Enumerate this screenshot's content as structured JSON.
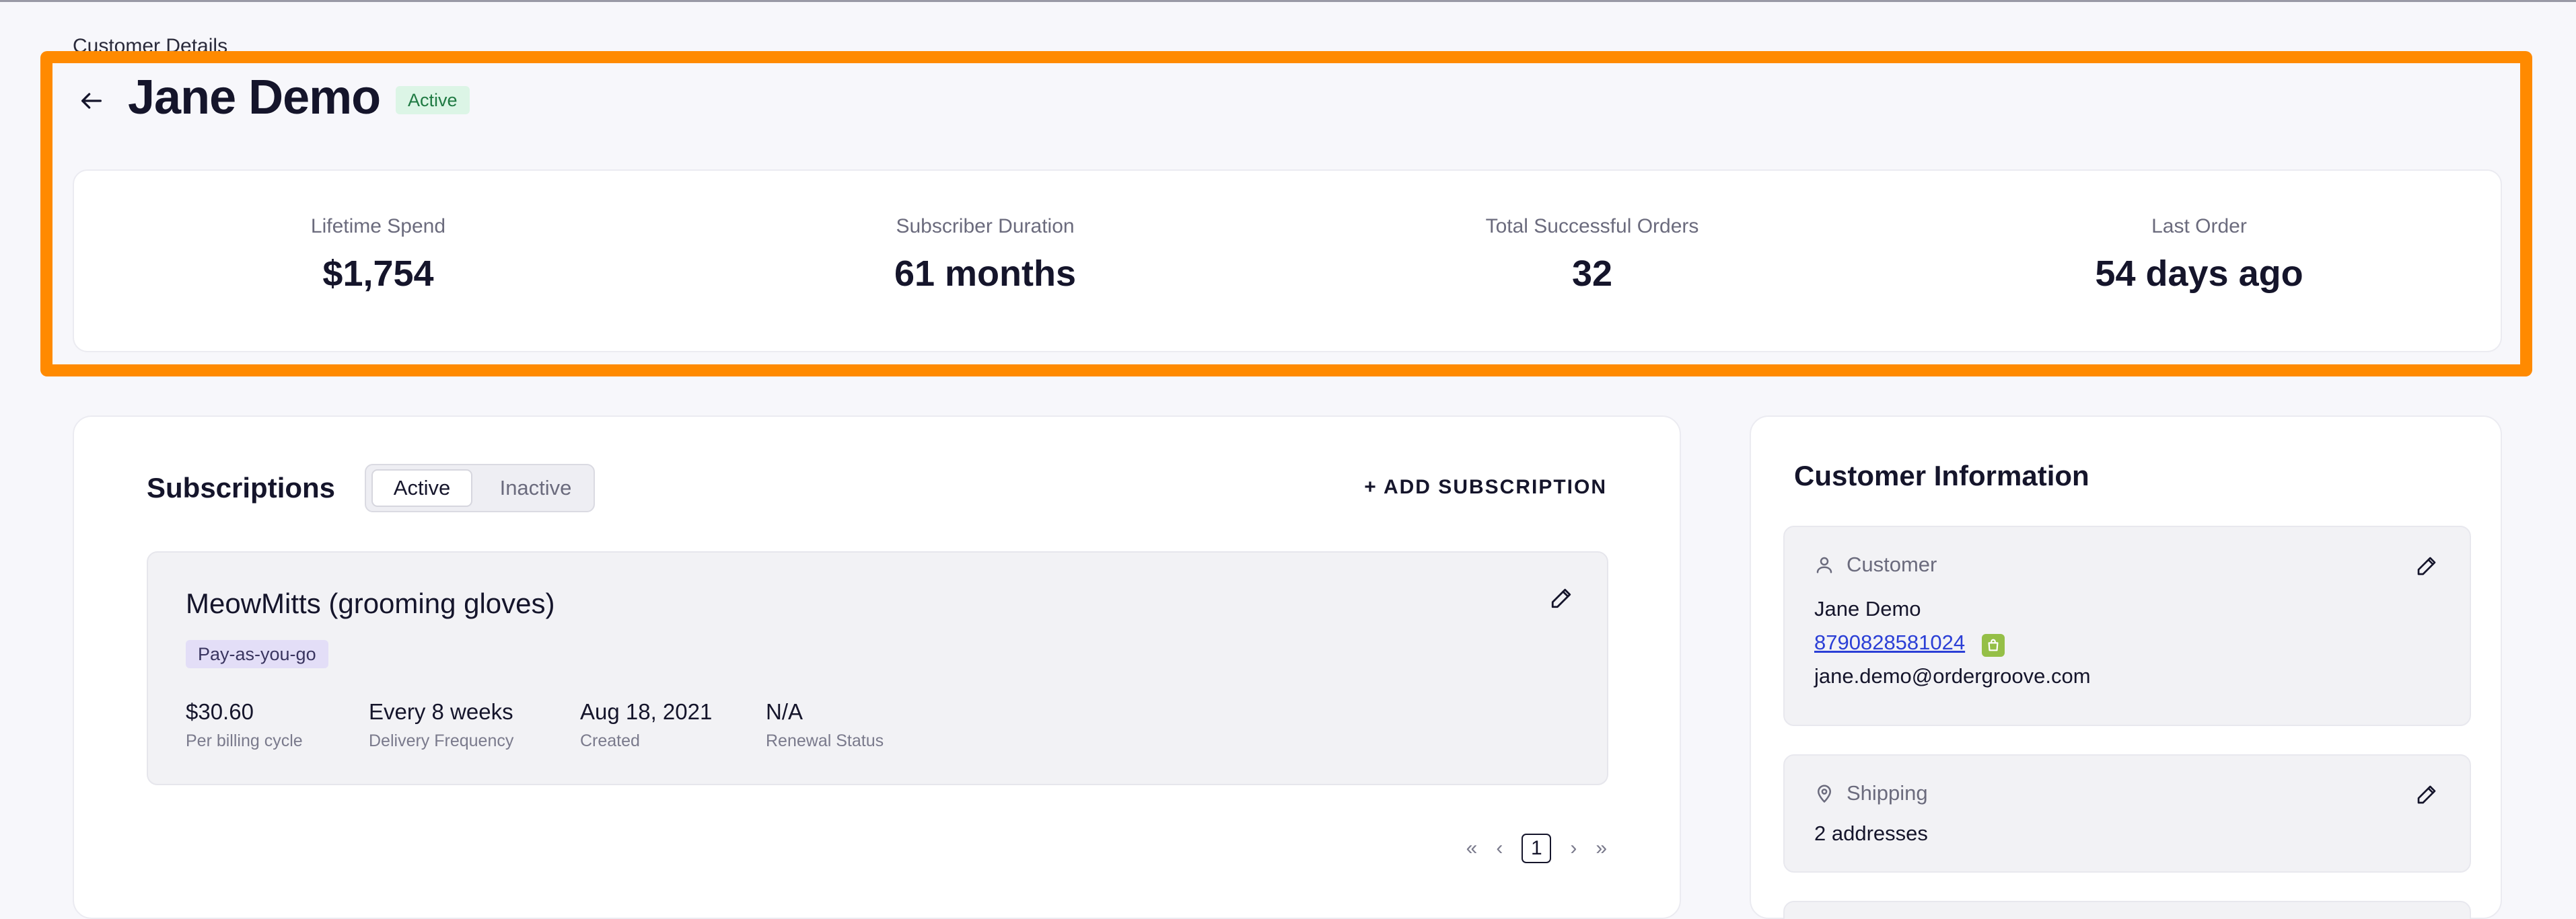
{
  "breadcrumb": "Customer Details",
  "customer": {
    "name": "Jane Demo",
    "status": "Active"
  },
  "stats": [
    {
      "label": "Lifetime Spend",
      "value": "$1,754"
    },
    {
      "label": "Subscriber Duration",
      "value": "61 months"
    },
    {
      "label": "Total Successful Orders",
      "value": "32"
    },
    {
      "label": "Last Order",
      "value": "54 days ago"
    }
  ],
  "subscriptions": {
    "title": "Subscriptions",
    "tabs": [
      "Active",
      "Inactive"
    ],
    "selected_tab": "Active",
    "add_label": "+ ADD SUBSCRIPTION",
    "items": [
      {
        "name": "MeowMitts (grooming gloves)",
        "plan": "Pay-as-you-go",
        "fields": [
          {
            "value": "$30.60",
            "label": "Per billing cycle"
          },
          {
            "value": "Every 8 weeks",
            "label": "Delivery Frequency"
          },
          {
            "value": "Aug 18, 2021",
            "label": "Created"
          },
          {
            "value": "N/A",
            "label": "Renewal Status"
          }
        ]
      }
    ],
    "pagination": {
      "first": "«",
      "prev": "‹",
      "current": "1",
      "next": "›",
      "last": "»"
    }
  },
  "customer_info": {
    "title": "Customer Information",
    "customer_section": {
      "heading": "Customer",
      "name": "Jane Demo",
      "phone": "8790828581024",
      "email": "jane.demo@ordergroove.com"
    },
    "shipping_section": {
      "heading": "Shipping",
      "summary": "2 addresses"
    }
  },
  "colors": {
    "highlight": "#ff8a00",
    "active_badge_bg": "#dcf5e6",
    "plan_badge_bg": "#e3def7",
    "link": "#2b3fd6",
    "shopify_icon": "#95bf47"
  }
}
